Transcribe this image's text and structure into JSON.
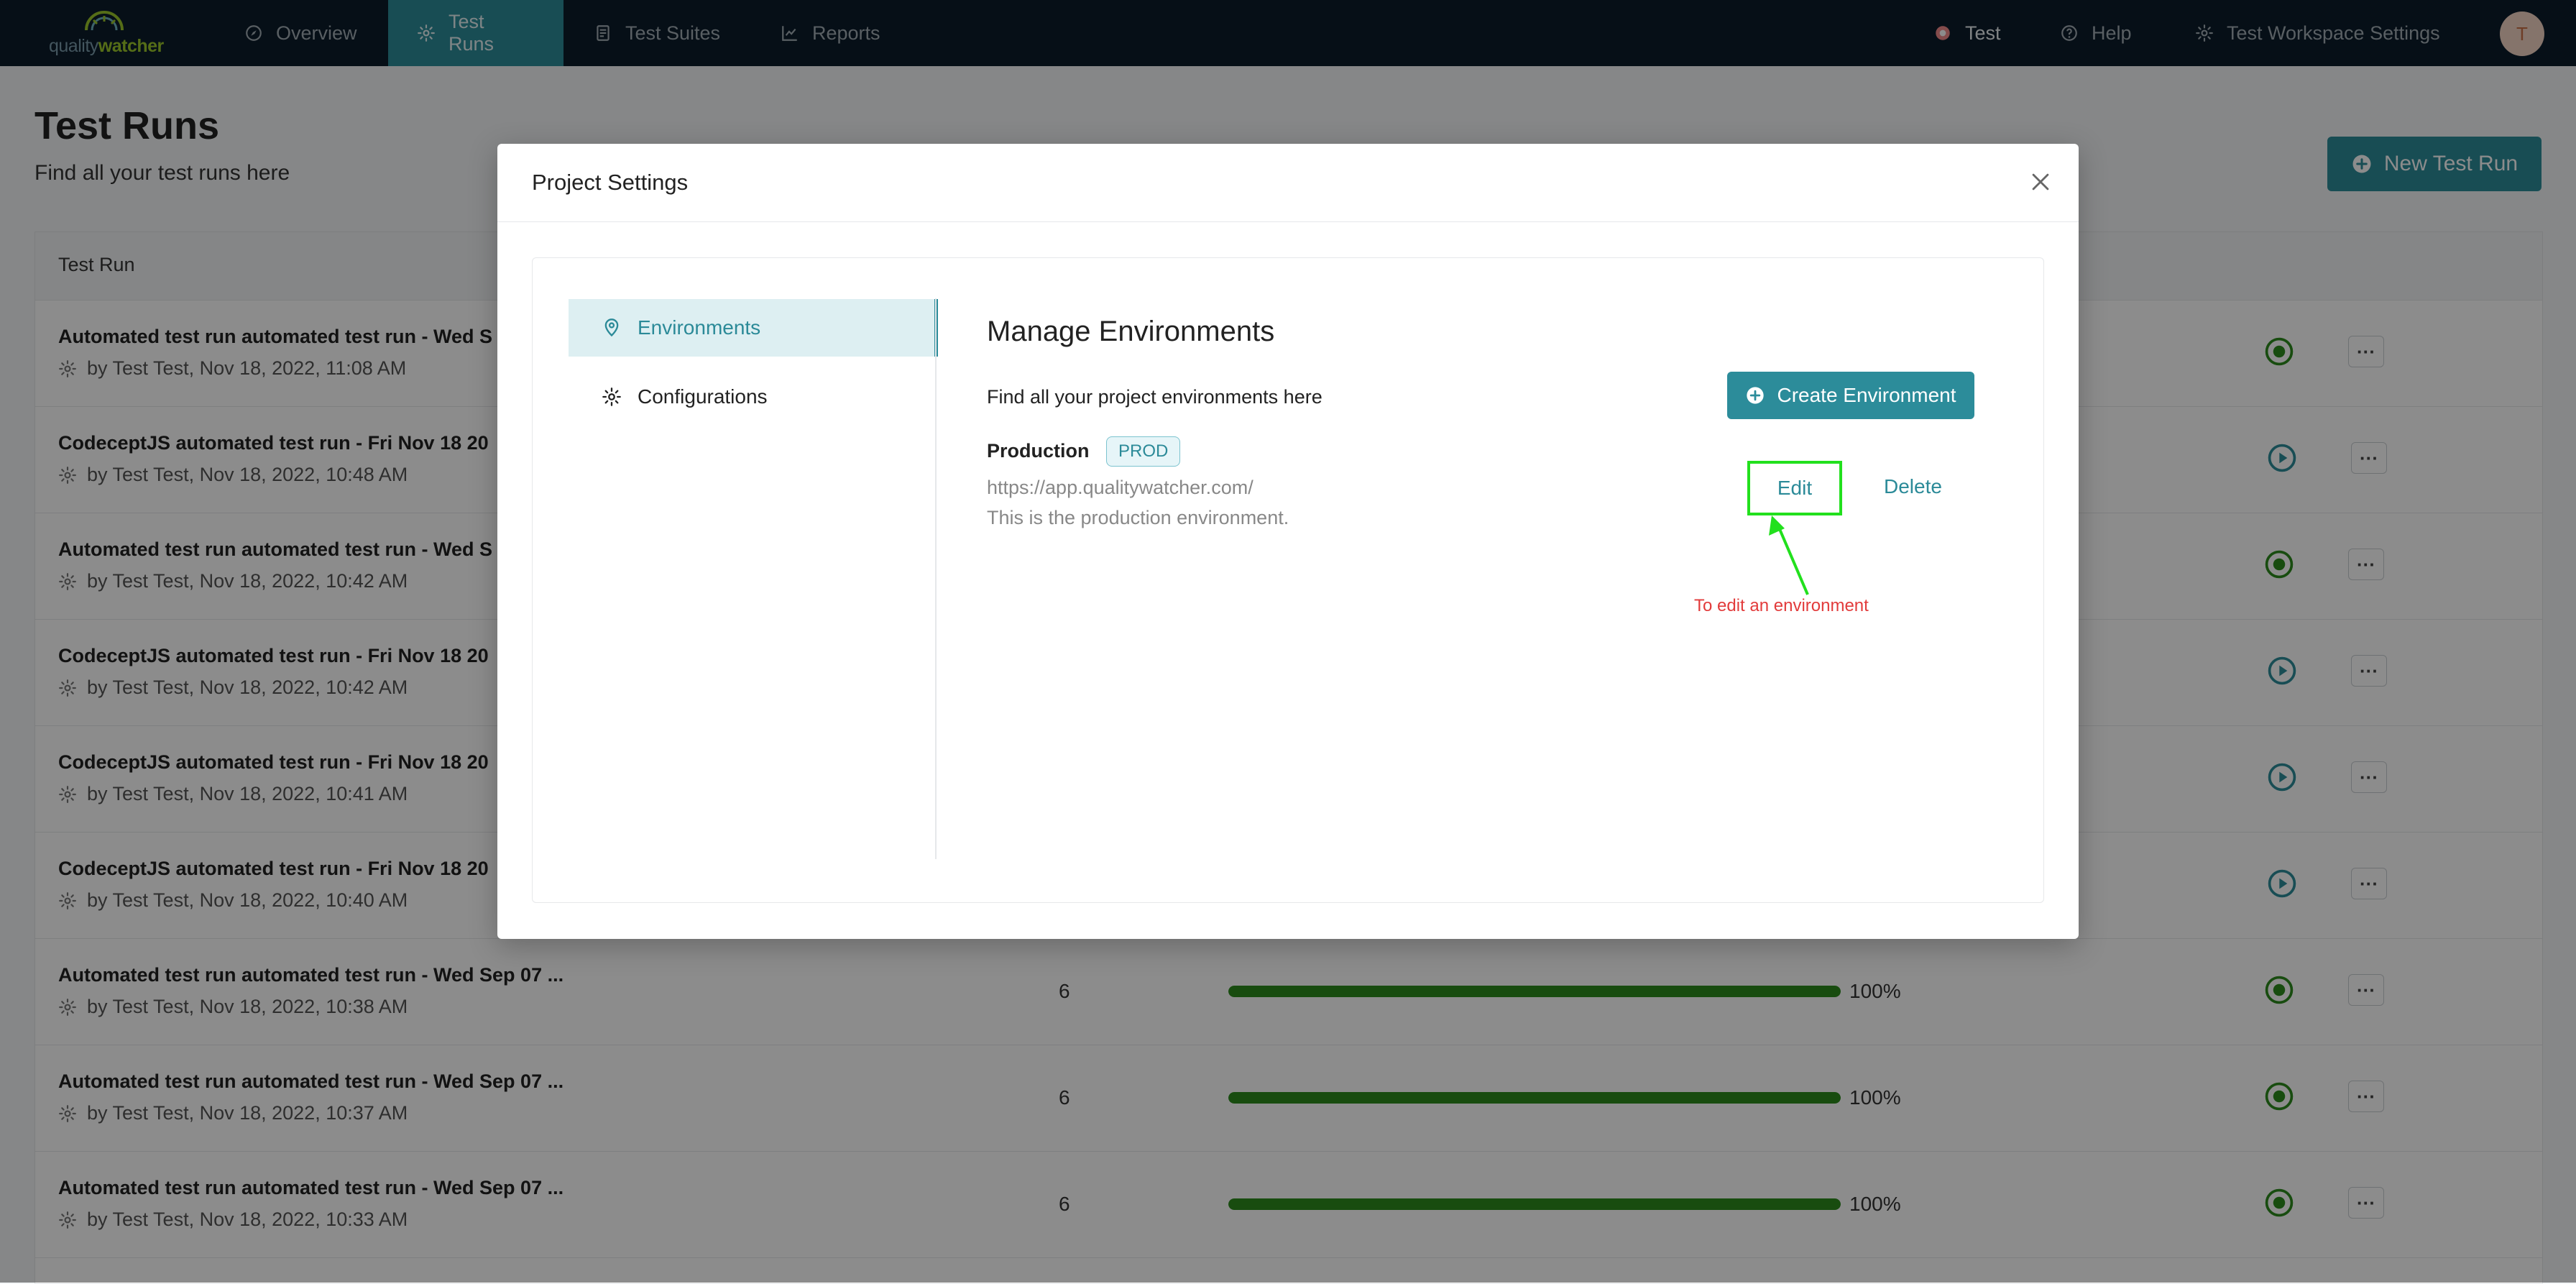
{
  "nav": {
    "logo": {
      "part1": "quality",
      "part2": "watcher"
    },
    "items": [
      {
        "label": "Overview",
        "icon": "compass-icon"
      },
      {
        "label": "Test Runs",
        "icon": "gear-icon",
        "active": true
      },
      {
        "label": "Test Suites",
        "icon": "document-icon"
      },
      {
        "label": "Reports",
        "icon": "chart-icon"
      }
    ],
    "right": [
      {
        "label": "Test",
        "icon": "workspace-icon"
      },
      {
        "label": "Help",
        "icon": "help-icon"
      },
      {
        "label": "Test Workspace Settings",
        "icon": "gear-icon"
      }
    ],
    "avatar": "T"
  },
  "page": {
    "title": "Test Runs",
    "subtitle": "Find all your test runs here",
    "new_button": "New Test Run"
  },
  "table": {
    "header": "Test Run",
    "rows": [
      {
        "name": "Automated test run automated test run - Wed S",
        "meta": "by Test Test, Nov 18, 2022, 11:08 AM"
      },
      {
        "name": "CodeceptJS automated test run - Fri Nov 18 20",
        "meta": "by Test Test, Nov 18, 2022, 10:48 AM"
      },
      {
        "name": "Automated test run automated test run - Wed S",
        "meta": "by Test Test, Nov 18, 2022, 10:42 AM"
      },
      {
        "name": "CodeceptJS automated test run - Fri Nov 18 20",
        "meta": "by Test Test, Nov 18, 2022, 10:42 AM"
      },
      {
        "name": "CodeceptJS automated test run - Fri Nov 18 20",
        "meta": "by Test Test, Nov 18, 2022, 10:41 AM"
      },
      {
        "name": "CodeceptJS automated test run - Fri Nov 18 20",
        "meta": "by Test Test, Nov 18, 2022, 10:40 AM"
      },
      {
        "name": "Automated test run automated test run - Wed Sep 07 ...",
        "meta": "by Test Test, Nov 18, 2022, 10:38 AM",
        "count": "6",
        "progress": 1.0,
        "pct": "100%"
      },
      {
        "name": "Automated test run automated test run - Wed Sep 07 ...",
        "meta": "by Test Test, Nov 18, 2022, 10:37 AM",
        "count": "6",
        "progress": 1.0,
        "pct": "100%"
      },
      {
        "name": "Automated test run automated test run - Wed Sep 07 ...",
        "meta": "by Test Test, Nov 18, 2022, 10:33 AM",
        "count": "6",
        "progress": 1.0,
        "pct": "100%"
      }
    ],
    "more_label": "···"
  },
  "modal": {
    "title": "Project Settings",
    "sidebar": [
      {
        "label": "Environments",
        "icon": "location-pin-icon",
        "active": true
      },
      {
        "label": "Configurations",
        "icon": "gear-icon"
      }
    ],
    "heading": "Manage Environments",
    "subheading": "Find all your project environments here",
    "create_button": "Create Environment",
    "environment": {
      "name": "Production",
      "badge": "PROD",
      "url": "https://app.qualitywatcher.com/",
      "description": "This is the production environment.",
      "edit": "Edit",
      "delete": "Delete"
    },
    "annotation": "To edit an environment"
  },
  "colors": {
    "accent": "#2c8c9a",
    "nav_bg": "#0c1d2b",
    "progress": "#2c8a1d",
    "annotation_box": "#22e01d",
    "annotation_text": "#e23b3b"
  }
}
